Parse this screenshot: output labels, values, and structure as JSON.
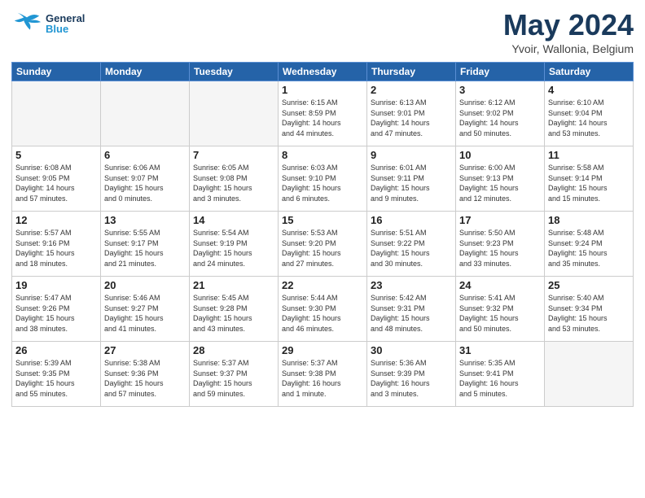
{
  "header": {
    "logo_general": "General",
    "logo_blue": "Blue",
    "month": "May 2024",
    "location": "Yvoir, Wallonia, Belgium"
  },
  "weekdays": [
    "Sunday",
    "Monday",
    "Tuesday",
    "Wednesday",
    "Thursday",
    "Friday",
    "Saturday"
  ],
  "weeks": [
    [
      {
        "day": "",
        "info": ""
      },
      {
        "day": "",
        "info": ""
      },
      {
        "day": "",
        "info": ""
      },
      {
        "day": "1",
        "info": "Sunrise: 6:15 AM\nSunset: 8:59 PM\nDaylight: 14 hours\nand 44 minutes."
      },
      {
        "day": "2",
        "info": "Sunrise: 6:13 AM\nSunset: 9:01 PM\nDaylight: 14 hours\nand 47 minutes."
      },
      {
        "day": "3",
        "info": "Sunrise: 6:12 AM\nSunset: 9:02 PM\nDaylight: 14 hours\nand 50 minutes."
      },
      {
        "day": "4",
        "info": "Sunrise: 6:10 AM\nSunset: 9:04 PM\nDaylight: 14 hours\nand 53 minutes."
      }
    ],
    [
      {
        "day": "5",
        "info": "Sunrise: 6:08 AM\nSunset: 9:05 PM\nDaylight: 14 hours\nand 57 minutes."
      },
      {
        "day": "6",
        "info": "Sunrise: 6:06 AM\nSunset: 9:07 PM\nDaylight: 15 hours\nand 0 minutes."
      },
      {
        "day": "7",
        "info": "Sunrise: 6:05 AM\nSunset: 9:08 PM\nDaylight: 15 hours\nand 3 minutes."
      },
      {
        "day": "8",
        "info": "Sunrise: 6:03 AM\nSunset: 9:10 PM\nDaylight: 15 hours\nand 6 minutes."
      },
      {
        "day": "9",
        "info": "Sunrise: 6:01 AM\nSunset: 9:11 PM\nDaylight: 15 hours\nand 9 minutes."
      },
      {
        "day": "10",
        "info": "Sunrise: 6:00 AM\nSunset: 9:13 PM\nDaylight: 15 hours\nand 12 minutes."
      },
      {
        "day": "11",
        "info": "Sunrise: 5:58 AM\nSunset: 9:14 PM\nDaylight: 15 hours\nand 15 minutes."
      }
    ],
    [
      {
        "day": "12",
        "info": "Sunrise: 5:57 AM\nSunset: 9:16 PM\nDaylight: 15 hours\nand 18 minutes."
      },
      {
        "day": "13",
        "info": "Sunrise: 5:55 AM\nSunset: 9:17 PM\nDaylight: 15 hours\nand 21 minutes."
      },
      {
        "day": "14",
        "info": "Sunrise: 5:54 AM\nSunset: 9:19 PM\nDaylight: 15 hours\nand 24 minutes."
      },
      {
        "day": "15",
        "info": "Sunrise: 5:53 AM\nSunset: 9:20 PM\nDaylight: 15 hours\nand 27 minutes."
      },
      {
        "day": "16",
        "info": "Sunrise: 5:51 AM\nSunset: 9:22 PM\nDaylight: 15 hours\nand 30 minutes."
      },
      {
        "day": "17",
        "info": "Sunrise: 5:50 AM\nSunset: 9:23 PM\nDaylight: 15 hours\nand 33 minutes."
      },
      {
        "day": "18",
        "info": "Sunrise: 5:48 AM\nSunset: 9:24 PM\nDaylight: 15 hours\nand 35 minutes."
      }
    ],
    [
      {
        "day": "19",
        "info": "Sunrise: 5:47 AM\nSunset: 9:26 PM\nDaylight: 15 hours\nand 38 minutes."
      },
      {
        "day": "20",
        "info": "Sunrise: 5:46 AM\nSunset: 9:27 PM\nDaylight: 15 hours\nand 41 minutes."
      },
      {
        "day": "21",
        "info": "Sunrise: 5:45 AM\nSunset: 9:28 PM\nDaylight: 15 hours\nand 43 minutes."
      },
      {
        "day": "22",
        "info": "Sunrise: 5:44 AM\nSunset: 9:30 PM\nDaylight: 15 hours\nand 46 minutes."
      },
      {
        "day": "23",
        "info": "Sunrise: 5:42 AM\nSunset: 9:31 PM\nDaylight: 15 hours\nand 48 minutes."
      },
      {
        "day": "24",
        "info": "Sunrise: 5:41 AM\nSunset: 9:32 PM\nDaylight: 15 hours\nand 50 minutes."
      },
      {
        "day": "25",
        "info": "Sunrise: 5:40 AM\nSunset: 9:34 PM\nDaylight: 15 hours\nand 53 minutes."
      }
    ],
    [
      {
        "day": "26",
        "info": "Sunrise: 5:39 AM\nSunset: 9:35 PM\nDaylight: 15 hours\nand 55 minutes."
      },
      {
        "day": "27",
        "info": "Sunrise: 5:38 AM\nSunset: 9:36 PM\nDaylight: 15 hours\nand 57 minutes."
      },
      {
        "day": "28",
        "info": "Sunrise: 5:37 AM\nSunset: 9:37 PM\nDaylight: 15 hours\nand 59 minutes."
      },
      {
        "day": "29",
        "info": "Sunrise: 5:37 AM\nSunset: 9:38 PM\nDaylight: 16 hours\nand 1 minute."
      },
      {
        "day": "30",
        "info": "Sunrise: 5:36 AM\nSunset: 9:39 PM\nDaylight: 16 hours\nand 3 minutes."
      },
      {
        "day": "31",
        "info": "Sunrise: 5:35 AM\nSunset: 9:41 PM\nDaylight: 16 hours\nand 5 minutes."
      },
      {
        "day": "",
        "info": ""
      }
    ]
  ]
}
